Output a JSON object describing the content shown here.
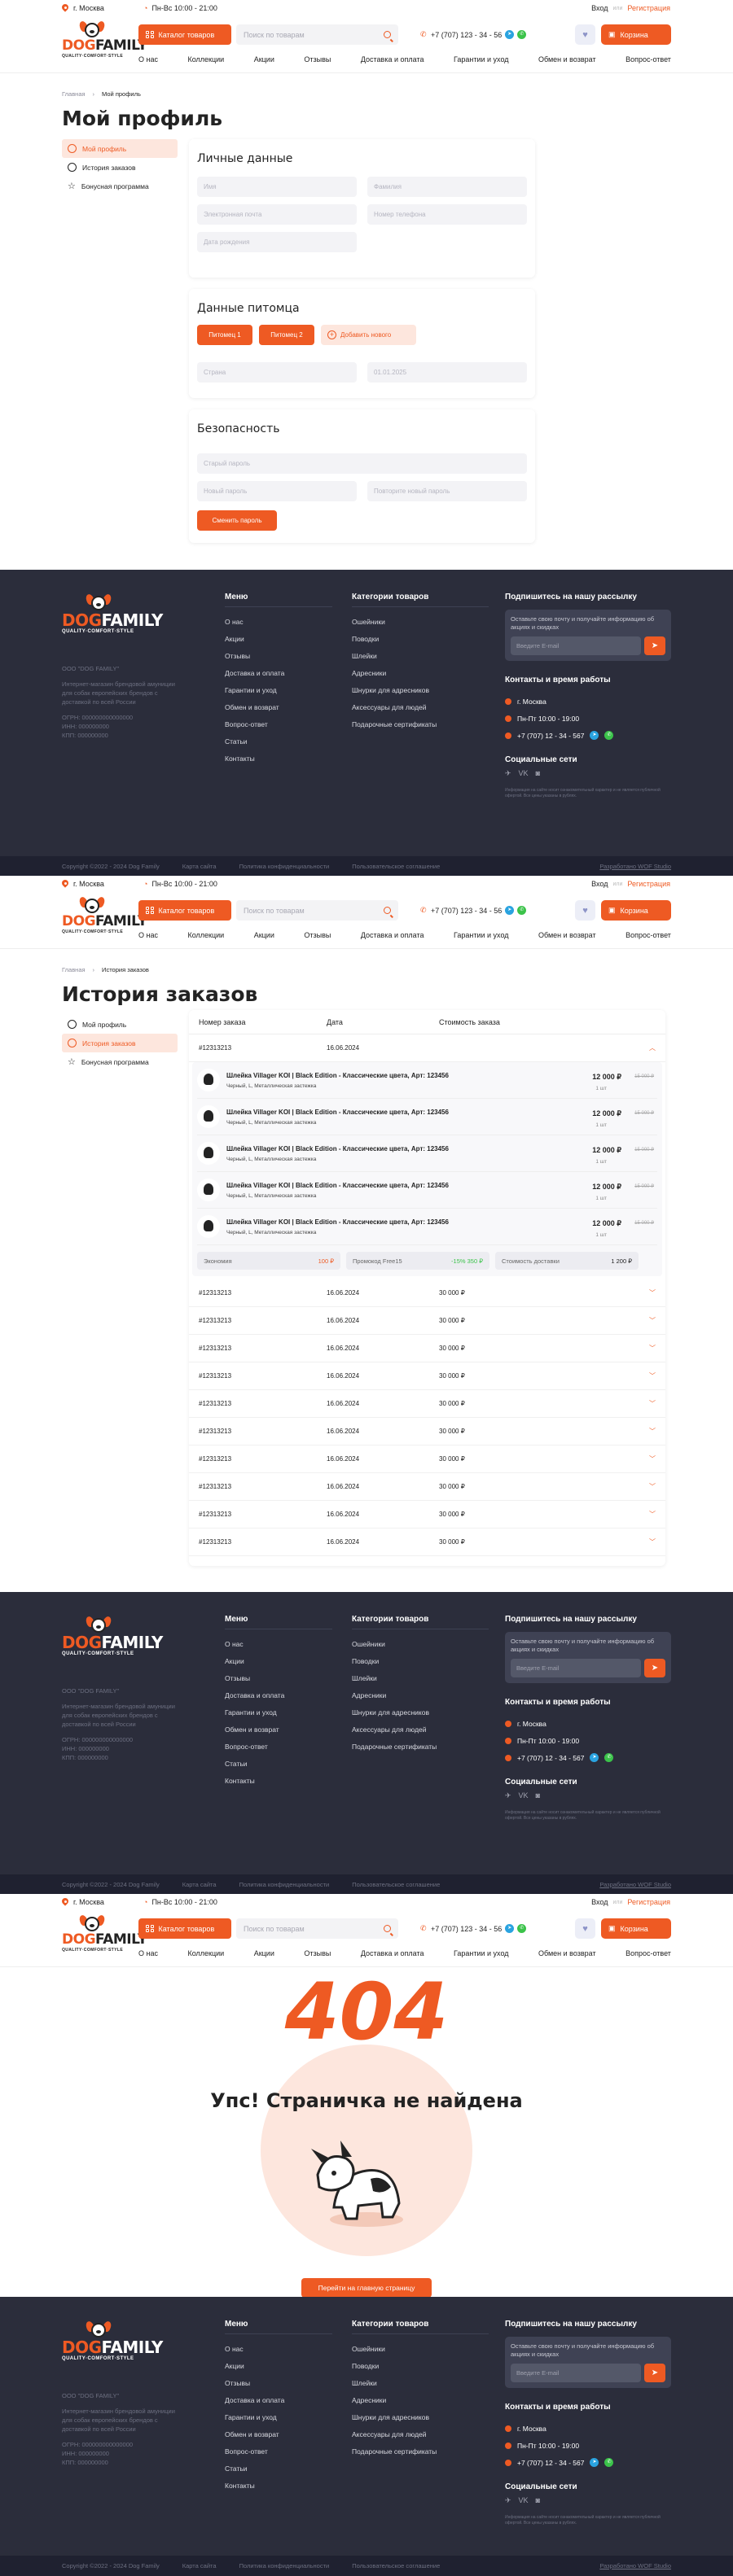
{
  "header": {
    "city": "г. Москва",
    "hours": "Пн-Вс  10:00 - 21:00",
    "login": "Вход",
    "or": "или",
    "register": "Регистрация",
    "logo_word_1": "DOG",
    "logo_word_2": "FAMILY",
    "logo_tagline": "QUALITY·COMFORT·STYLE",
    "catalog_button": "Каталог товаров",
    "search_placeholder": "Поиск по товарам",
    "phone": "+7 (707) 123 - 34 - 56",
    "cart_button": "Корзина",
    "nav": [
      "О нас",
      "Коллекции",
      "Акции",
      "Отзывы",
      "Доставка и оплата",
      "Гарантии и уход",
      "Обмен и возврат",
      "Вопрос-ответ"
    ]
  },
  "profile": {
    "breadcrumb": [
      "Главная",
      "Мой профиль"
    ],
    "title": "Мой профиль",
    "personal_title": "Личные данные",
    "fields": [
      "Имя",
      "Фамилия",
      "Электронная почта",
      "Номер телефона",
      "Дата рождения"
    ],
    "pet_title": "Данные питомца",
    "pet_tabs": [
      "Питомец 1",
      "Питомец 2"
    ],
    "add_pet": "Добавить нового",
    "pet_fields": [
      "Страна",
      "01.01.2025"
    ],
    "security_title": "Безопасность",
    "security_fields": [
      "Старый пароль",
      "Новый пароль",
      "Повторите новый пароль"
    ],
    "change_password": "Сменить пароль"
  },
  "sidebar": [
    "Мой профиль",
    "История заказов",
    "Бонусная программа"
  ],
  "footer": {
    "company": "ООО \"DOG FAMILY\"",
    "desc": "Интернет-магазин брендовой амуниции для собак европейских брендов с доставкой по всей России",
    "ids": [
      "ОГРН: 000000000000000",
      "ИНН: 000000000",
      "КПП: 000000000"
    ],
    "menu_title": "Меню",
    "menu": [
      "О нас",
      "Акции",
      "Отзывы",
      "Доставка и оплата",
      "Гарантии и уход",
      "Обмен и возврат",
      "Вопрос-ответ",
      "Статьи",
      "Контакты"
    ],
    "cat_title": "Категории товаров",
    "cats": [
      "Ошейники",
      "Поводки",
      "Шлейки",
      "Адресники",
      "Шнурки для адресников",
      "Аксессуары для людей",
      "Подарочные сертификаты"
    ],
    "sub_title": "Подпишитесь на нашу рассылку",
    "sub_text": "Оставьте свою почту и получайте информацию об акциях и скидках",
    "email_placeholder": "Введите E-mail",
    "contacts_title": "Контакты и время работы",
    "contact_city": "г. Москва",
    "contact_hours": "Пн-Пт  10:00 - 19:00",
    "contact_phone": "+7 (707) 12 - 34 - 567",
    "social_title": "Социальные сети",
    "social": [
      "✈",
      "VK",
      "◙"
    ],
    "legal": "Информация на сайте носит ознакомительный характер и не является публичной офертой. Все цены указаны в рублях.",
    "bottom": [
      "Copyright ©2022 - 2024 Dog Family",
      "Карта сайта",
      "Политика конфиденциальности",
      "Пользовательское соглашение"
    ],
    "dev": "Разработано WOF Studio"
  },
  "orders": {
    "breadcrumb": [
      "Главная",
      "История заказов"
    ],
    "title": "История заказов",
    "head": [
      "Номер заказа",
      "Дата",
      "Стоимость заказа"
    ],
    "open_order": {
      "num": "#12313213",
      "date": "16.06.2024",
      "sum": ""
    },
    "products": [
      {
        "name": "Шлейка Villager KOI | Black Edition - Классические цвета, Арт: 123456",
        "variant": "Черный, L, Металлическая застежка",
        "price": "12 000 ₽",
        "old": "15 000 ₽",
        "qty": "1 шт"
      },
      {
        "name": "Шлейка Villager KOI | Black Edition - Классические цвета, Арт: 123456",
        "variant": "Черный, L, Металлическая застежка",
        "price": "12 000 ₽",
        "old": "15 000 ₽",
        "qty": "1 шт"
      },
      {
        "name": "Шлейка Villager KOI | Black Edition - Классические цвета, Арт: 123456",
        "variant": "Черный, L, Металлическая застежка",
        "price": "12 000 ₽",
        "old": "15 000 ₽",
        "qty": "1 шт"
      },
      {
        "name": "Шлейка Villager KOI | Black Edition - Классические цвета, Арт: 123456",
        "variant": "Черный, L, Металлическая застежка",
        "price": "12 000 ₽",
        "old": "15 000 ₽",
        "qty": "1 шт"
      },
      {
        "name": "Шлейка Villager KOI | Black Edition - Классические цвета, Арт: 123456",
        "variant": "Черный, L, Металлическая застежка",
        "price": "12 000 ₽",
        "old": "15 000 ₽",
        "qty": "1 шт"
      }
    ],
    "summary": [
      {
        "label": "Экономия",
        "value": "100 ₽"
      },
      {
        "label": "Промокод Free15",
        "value": "-15%  350 ₽"
      },
      {
        "label": "Стоимость доставки",
        "value": "1 200 ₽"
      }
    ],
    "rows": [
      {
        "num": "#12313213",
        "date": "16.06.2024",
        "sum": "30 000 ₽"
      },
      {
        "num": "#12313213",
        "date": "16.06.2024",
        "sum": "30 000 ₽"
      },
      {
        "num": "#12313213",
        "date": "16.06.2024",
        "sum": "30 000 ₽"
      },
      {
        "num": "#12313213",
        "date": "16.06.2024",
        "sum": "30 000 ₽"
      },
      {
        "num": "#12313213",
        "date": "16.06.2024",
        "sum": "30 000 ₽"
      },
      {
        "num": "#12313213",
        "date": "16.06.2024",
        "sum": "30 000 ₽"
      },
      {
        "num": "#12313213",
        "date": "16.06.2024",
        "sum": "30 000 ₽"
      },
      {
        "num": "#12313213",
        "date": "16.06.2024",
        "sum": "30 000 ₽"
      },
      {
        "num": "#12313213",
        "date": "16.06.2024",
        "sum": "30 000 ₽"
      },
      {
        "num": "#12313213",
        "date": "16.06.2024",
        "sum": "30 000 ₽"
      }
    ]
  },
  "notfound": {
    "code": "404",
    "title": "Упс! Страничка не найдена",
    "button": "Перейти на главную страницу"
  },
  "colors": {
    "accent": "#ee5a23",
    "footer": "#2b2d3b"
  }
}
